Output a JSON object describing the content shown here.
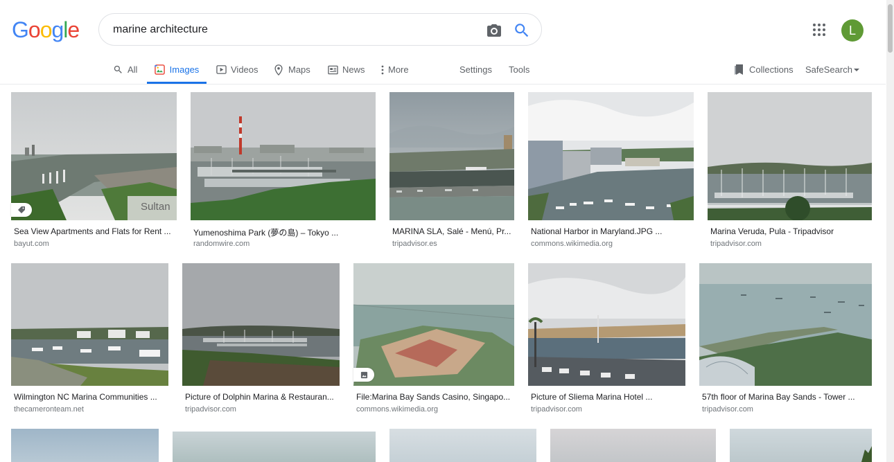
{
  "search": {
    "query": "marine architecture"
  },
  "logo": {
    "letters": [
      "G",
      "o",
      "o",
      "g",
      "l",
      "e"
    ],
    "colors": [
      "#4285f4",
      "#ea4335",
      "#fbbc05",
      "#4285f4",
      "#34a853",
      "#ea4335"
    ]
  },
  "account": {
    "initial": "L",
    "color": "#5f9a35"
  },
  "nav": {
    "tabs": [
      {
        "label": "All",
        "icon": "search-icon"
      },
      {
        "label": "Images",
        "icon": "image-icon",
        "active": true
      },
      {
        "label": "Videos",
        "icon": "play-icon"
      },
      {
        "label": "Maps",
        "icon": "pin-icon"
      },
      {
        "label": "News",
        "icon": "news-icon"
      },
      {
        "label": "More",
        "icon": "more-vert-icon"
      }
    ],
    "settings": "Settings",
    "tools": "Tools",
    "collections": "Collections",
    "safesearch": "SafeSearch"
  },
  "results": [
    {
      "caption": "Sea View Apartments and Flats for Rent ...",
      "source": "bayut.com",
      "overlay_text": "Sultan"
    },
    {
      "caption": "Yumenoshima Park (夢の島) – Tokyo ...",
      "source": "randomwire.com"
    },
    {
      "caption": "MARINA SLA, Salé - Menú, Pr...",
      "source": "tripadvisor.es"
    },
    {
      "caption": "National Harbor in Maryland.JPG ...",
      "source": "commons.wikimedia.org"
    },
    {
      "caption": "Marina Veruda, Pula - Tripadvisor",
      "source": "tripadvisor.com"
    },
    {
      "caption": "Wilmington NC Marina Communities ...",
      "source": "thecameronteam.net"
    },
    {
      "caption": "Picture of Dolphin Marina & Restauran...",
      "source": "tripadvisor.com"
    },
    {
      "caption": "File:Marina Bay Sands Casino, Singapo...",
      "source": "commons.wikimedia.org"
    },
    {
      "caption": "Picture of Sliema Marina Hotel ...",
      "source": "tripadvisor.com"
    },
    {
      "caption": "57th floor of Marina Bay Sands - Tower ...",
      "source": "tripadvisor.com"
    }
  ]
}
